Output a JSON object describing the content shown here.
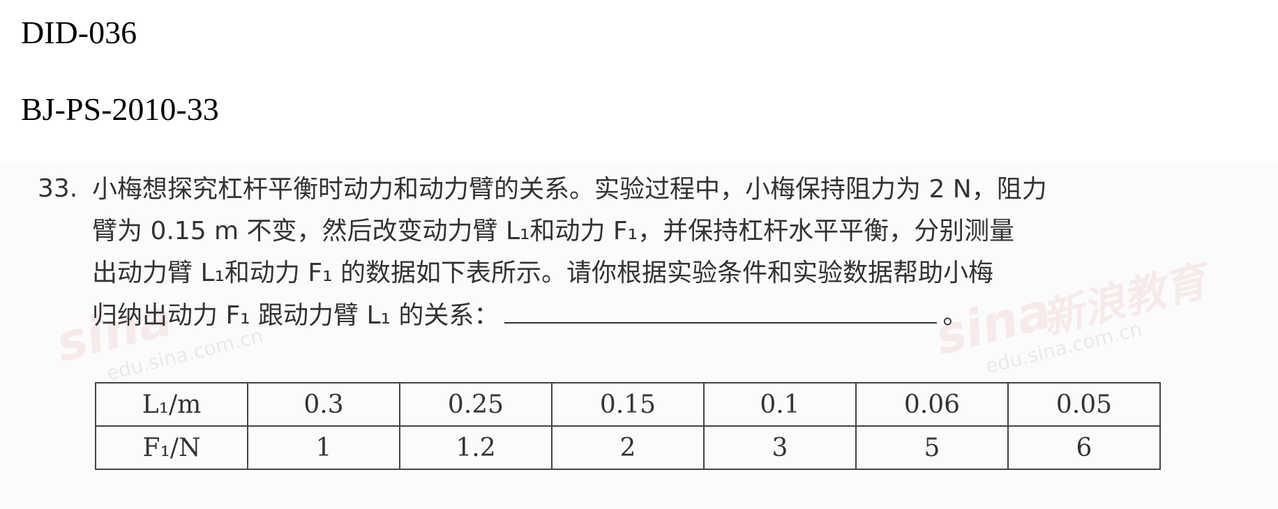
{
  "header": {
    "id_line1": "DID-036",
    "id_line2": "BJ-PS-2010-33"
  },
  "question": {
    "number": "33.",
    "lines": [
      "小梅想探究杠杆平衡时动力和动力臂的关系。实验过程中，小梅保持阻力为 2 N，阻力",
      "臂为 0.15  m 不变，然后改变动力臂 L₁和动力 F₁，并保持杠杆水平平衡，分别测量",
      "出动力臂 L₁和动力 F₁ 的数据如下表所示。请你根据实验条件和实验数据帮助小梅",
      "归纳出动力 F₁ 跟动力臂 L₁ 的关系："
    ],
    "end_mark": "。"
  },
  "table": {
    "row1_label": "L₁/m",
    "row2_label": "F₁/N",
    "L1_values": [
      "0.3",
      "0.25",
      "0.15",
      "0.1",
      "0.06",
      "0.05"
    ],
    "F1_values": [
      "1",
      "1.2",
      "2",
      "3",
      "5",
      "6"
    ]
  },
  "watermark": {
    "brand": "sina",
    "text_cn": "新浪教育",
    "domain": "edu.sina.com.cn"
  }
}
